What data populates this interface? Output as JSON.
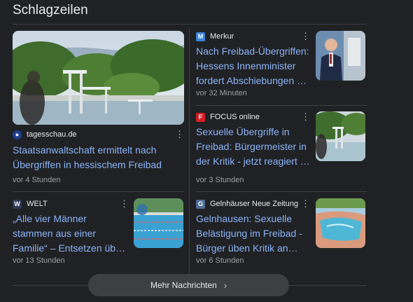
{
  "section": {
    "title": "Schlagzeilen"
  },
  "featured": {
    "source": "tagesschau.de",
    "headline": "Staatsanwaltschaft ermittelt nach Übergriffen in hessischem Freibad",
    "time": "vor 4 Stunden"
  },
  "articles": [
    {
      "source": "Merkur",
      "favicon_text": "M",
      "favicon_color": "#3a83d6",
      "headline": "Nach Freibad-Übergriffen: Hessens Innenminister fordert Abschiebungen – „kein Rec…",
      "time": "vor 32 Minuten"
    },
    {
      "source": "FOCUS online",
      "favicon_text": "F",
      "favicon_color": "#d21f25",
      "headline": "Sexuelle Übergriffe in Freibad: Bürgermeister in der Kritik - jetzt reagiert er auf…",
      "time": "vor 3 Stunden"
    },
    {
      "source": "WELT",
      "favicon_text": "W",
      "favicon_color": "#2f3a56",
      "headline": "„Alle vier Männer stammen aus einer Familie“ – Entsetzen über sexuelle…",
      "time": "vor 13 Stunden"
    },
    {
      "source": "Gelnhäuser Neue Zeitung",
      "favicon_text": "G",
      "favicon_color": "#4f6e95",
      "headline": "Gelnhausen: Sexuelle Belästigung im Freibad - Bürger üben Kritik an Stadt",
      "time": "vor 6 Stunden"
    }
  ],
  "more_button": {
    "label": "Mehr Nachrichten"
  },
  "icons": {
    "more": "more-vert-icon",
    "chevron": "chevron-right-icon"
  },
  "colors": {
    "background": "#202124",
    "link": "#8ab4f8",
    "muted": "#9aa0a6",
    "divider": "#3c4043"
  }
}
